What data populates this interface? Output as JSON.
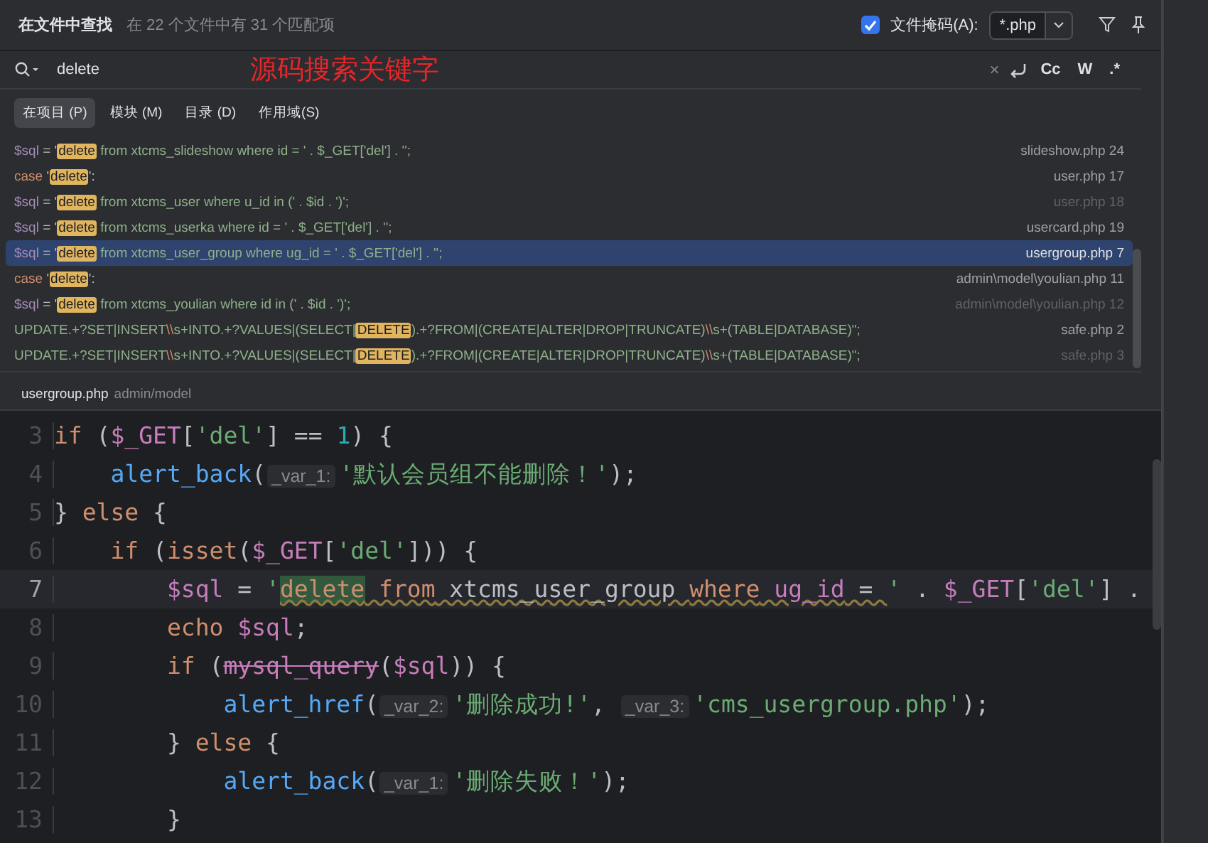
{
  "header": {
    "title": "在文件中查找",
    "summary": "在 22 个文件中有 31 个匹配项",
    "file_mask": {
      "checked": true,
      "label": "文件掩码(A):",
      "value": "*.php"
    }
  },
  "search": {
    "value": "delete",
    "annotation": "源码搜索关键字",
    "clear": "×",
    "options": [
      {
        "label": "Cc",
        "selected": false
      },
      {
        "label": "W",
        "selected": false
      },
      {
        "label": ".*",
        "selected": false
      }
    ]
  },
  "scopes": [
    {
      "label": "在项目 (P)",
      "selected": true
    },
    {
      "label": "模块 (M)",
      "selected": false
    },
    {
      "label": "目录 (D)",
      "selected": false
    },
    {
      "label": "作用域(S)",
      "selected": false
    }
  ],
  "results": [
    {
      "selected": false,
      "dimmed": false,
      "file": "slideshow.php 24",
      "segments": [
        {
          "kind": "var",
          "text": "$sql"
        },
        {
          "kind": "plain",
          "text": " = '"
        },
        {
          "kind": "match",
          "text": "delete"
        },
        {
          "kind": "str",
          "text": " from xtcms_slideshow where id = ' . $_GET['del'] . '';"
        }
      ]
    },
    {
      "selected": false,
      "dimmed": false,
      "file": "user.php 17",
      "segments": [
        {
          "kind": "kw",
          "text": "case"
        },
        {
          "kind": "plain",
          "text": " '"
        },
        {
          "kind": "match",
          "text": "delete"
        },
        {
          "kind": "plain",
          "text": "':"
        }
      ]
    },
    {
      "selected": false,
      "dimmed": true,
      "file": "user.php 18",
      "segments": [
        {
          "kind": "var",
          "text": "$sql"
        },
        {
          "kind": "plain",
          "text": " = '"
        },
        {
          "kind": "match",
          "text": "delete"
        },
        {
          "kind": "str",
          "text": " from xtcms_user where u_id in (' . $id . ')';"
        }
      ]
    },
    {
      "selected": false,
      "dimmed": false,
      "file": "usercard.php 19",
      "segments": [
        {
          "kind": "var",
          "text": "$sql"
        },
        {
          "kind": "plain",
          "text": " = '"
        },
        {
          "kind": "match",
          "text": "delete"
        },
        {
          "kind": "str",
          "text": " from xtcms_userka where id = ' . $_GET['del'] . '';"
        }
      ]
    },
    {
      "selected": true,
      "dimmed": false,
      "file": "usergroup.php 7",
      "segments": [
        {
          "kind": "var",
          "text": "$sql"
        },
        {
          "kind": "plain",
          "text": " = '"
        },
        {
          "kind": "match",
          "text": "delete"
        },
        {
          "kind": "str",
          "text": " from xtcms_user_group where ug_id = ' . $_GET['del'] . '';"
        }
      ]
    },
    {
      "selected": false,
      "dimmed": false,
      "file": "admin\\model\\youlian.php 11",
      "segments": [
        {
          "kind": "kw",
          "text": "case"
        },
        {
          "kind": "plain",
          "text": " '"
        },
        {
          "kind": "match",
          "text": "delete"
        },
        {
          "kind": "plain",
          "text": "':"
        }
      ]
    },
    {
      "selected": false,
      "dimmed": true,
      "file": "admin\\model\\youlian.php 12",
      "segments": [
        {
          "kind": "var",
          "text": "$sql"
        },
        {
          "kind": "plain",
          "text": " = '"
        },
        {
          "kind": "match",
          "text": "delete"
        },
        {
          "kind": "str",
          "text": " from xtcms_youlian where id in (' . $id . ')';"
        }
      ]
    },
    {
      "selected": false,
      "dimmed": false,
      "file": "safe.php 2",
      "segments": [
        {
          "kind": "str",
          "text": "UPDATE.+?SET|INSERT"
        },
        {
          "kind": "esc",
          "text": "\\\\"
        },
        {
          "kind": "str",
          "text": "s+INTO.+?VALUES|(SELECT|"
        },
        {
          "kind": "match",
          "text": "DELETE"
        },
        {
          "kind": "str",
          "text": ").+?FROM|(CREATE|ALTER|DROP|TRUNCATE)"
        },
        {
          "kind": "esc",
          "text": "\\\\"
        },
        {
          "kind": "str",
          "text": "s+(TABLE|DATABASE)\";"
        }
      ]
    },
    {
      "selected": false,
      "dimmed": true,
      "file": "safe.php 3",
      "segments": [
        {
          "kind": "str",
          "text": "UPDATE.+?SET|INSERT"
        },
        {
          "kind": "esc",
          "text": "\\\\"
        },
        {
          "kind": "str",
          "text": "s+INTO.+?VALUES|(SELECT|"
        },
        {
          "kind": "match",
          "text": "DELETE"
        },
        {
          "kind": "str",
          "text": ").+?FROM|(CREATE|ALTER|DROP|TRUNCATE)"
        },
        {
          "kind": "esc",
          "text": "\\\\"
        },
        {
          "kind": "str",
          "text": "s+(TABLE|DATABASE)\";"
        }
      ]
    }
  ],
  "preview": {
    "file": "usergroup.php",
    "path": "admin/model"
  },
  "editor": {
    "lines": [
      {
        "number": "3",
        "current": false,
        "tokens": [
          {
            "kind": "kw",
            "text": "if"
          },
          {
            "kind": "plain",
            "text": " ("
          },
          {
            "kind": "var",
            "text": "$_GET"
          },
          {
            "kind": "plain",
            "text": "["
          },
          {
            "kind": "str",
            "text": "'del'"
          },
          {
            "kind": "plain",
            "text": "] == "
          },
          {
            "kind": "num",
            "text": "1"
          },
          {
            "kind": "plain",
            "text": ") {"
          }
        ]
      },
      {
        "number": "4",
        "current": false,
        "tokens": [
          {
            "kind": "fn",
            "text": "    alert_back"
          },
          {
            "kind": "plain",
            "text": "("
          },
          {
            "kind": "hint",
            "text": "_var_1:"
          },
          {
            "kind": "str",
            "text": "'默认会员组不能删除！'"
          },
          {
            "kind": "plain",
            "text": ");"
          }
        ]
      },
      {
        "number": "5",
        "current": false,
        "tokens": [
          {
            "kind": "plain",
            "text": "} "
          },
          {
            "kind": "kw",
            "text": "else"
          },
          {
            "kind": "plain",
            "text": " {"
          }
        ]
      },
      {
        "number": "6",
        "current": false,
        "tokens": [
          {
            "kind": "kw",
            "text": "    if"
          },
          {
            "kind": "plain",
            "text": " ("
          },
          {
            "kind": "kw",
            "text": "isset"
          },
          {
            "kind": "plain",
            "text": "("
          },
          {
            "kind": "var",
            "text": "$_GET"
          },
          {
            "kind": "plain",
            "text": "["
          },
          {
            "kind": "str",
            "text": "'del'"
          },
          {
            "kind": "plain",
            "text": "])) {"
          }
        ]
      },
      {
        "number": "7",
        "current": true,
        "tokens": [
          {
            "kind": "var",
            "text": "        $sql"
          },
          {
            "kind": "plain",
            "text": " = "
          },
          {
            "kind": "str",
            "text": "'"
          },
          {
            "kind": "match",
            "text": "delete"
          },
          {
            "kind": "sqlkw",
            "text": " from"
          },
          {
            "kind": "sql",
            "text": " xtcms_user_group "
          },
          {
            "kind": "sqlkw",
            "text": "where"
          },
          {
            "kind": "col",
            "text": " ug_id"
          },
          {
            "kind": "sql",
            "text": " = "
          },
          {
            "kind": "str",
            "text": "'"
          },
          {
            "kind": "plain",
            "text": " . "
          },
          {
            "kind": "var",
            "text": "$_GET"
          },
          {
            "kind": "plain",
            "text": "["
          },
          {
            "kind": "str",
            "text": "'del'"
          },
          {
            "kind": "plain",
            "text": "] ."
          }
        ]
      },
      {
        "number": "8",
        "current": false,
        "tokens": [
          {
            "kind": "kw",
            "text": "        echo"
          },
          {
            "kind": "var",
            "text": " $sql"
          },
          {
            "kind": "plain",
            "text": ";"
          }
        ]
      },
      {
        "number": "9",
        "current": false,
        "tokens": [
          {
            "kind": "kw",
            "text": "        if"
          },
          {
            "kind": "plain",
            "text": " ("
          },
          {
            "kind": "deprecated",
            "text": "mysql_query"
          },
          {
            "kind": "plain",
            "text": "("
          },
          {
            "kind": "var",
            "text": "$sql"
          },
          {
            "kind": "plain",
            "text": ")) {"
          }
        ]
      },
      {
        "number": "10",
        "current": false,
        "tokens": [
          {
            "kind": "fn",
            "text": "            alert_href"
          },
          {
            "kind": "plain",
            "text": "("
          },
          {
            "kind": "hint",
            "text": "_var_2:"
          },
          {
            "kind": "str",
            "text": "'删除成功!'"
          },
          {
            "kind": "plain",
            "text": ", "
          },
          {
            "kind": "hint",
            "text": "_var_3:"
          },
          {
            "kind": "str",
            "text": "'cms_usergroup.php'"
          },
          {
            "kind": "plain",
            "text": ");"
          }
        ]
      },
      {
        "number": "11",
        "current": false,
        "tokens": [
          {
            "kind": "plain",
            "text": "        } "
          },
          {
            "kind": "kw",
            "text": "else"
          },
          {
            "kind": "plain",
            "text": " {"
          }
        ]
      },
      {
        "number": "12",
        "current": false,
        "tokens": [
          {
            "kind": "fn",
            "text": "            alert_back"
          },
          {
            "kind": "plain",
            "text": "("
          },
          {
            "kind": "hint",
            "text": "_var_1:"
          },
          {
            "kind": "str",
            "text": "'删除失败！'"
          },
          {
            "kind": "plain",
            "text": ");"
          }
        ]
      },
      {
        "number": "13",
        "current": false,
        "tokens": [
          {
            "kind": "plain",
            "text": "        }"
          }
        ]
      }
    ]
  }
}
